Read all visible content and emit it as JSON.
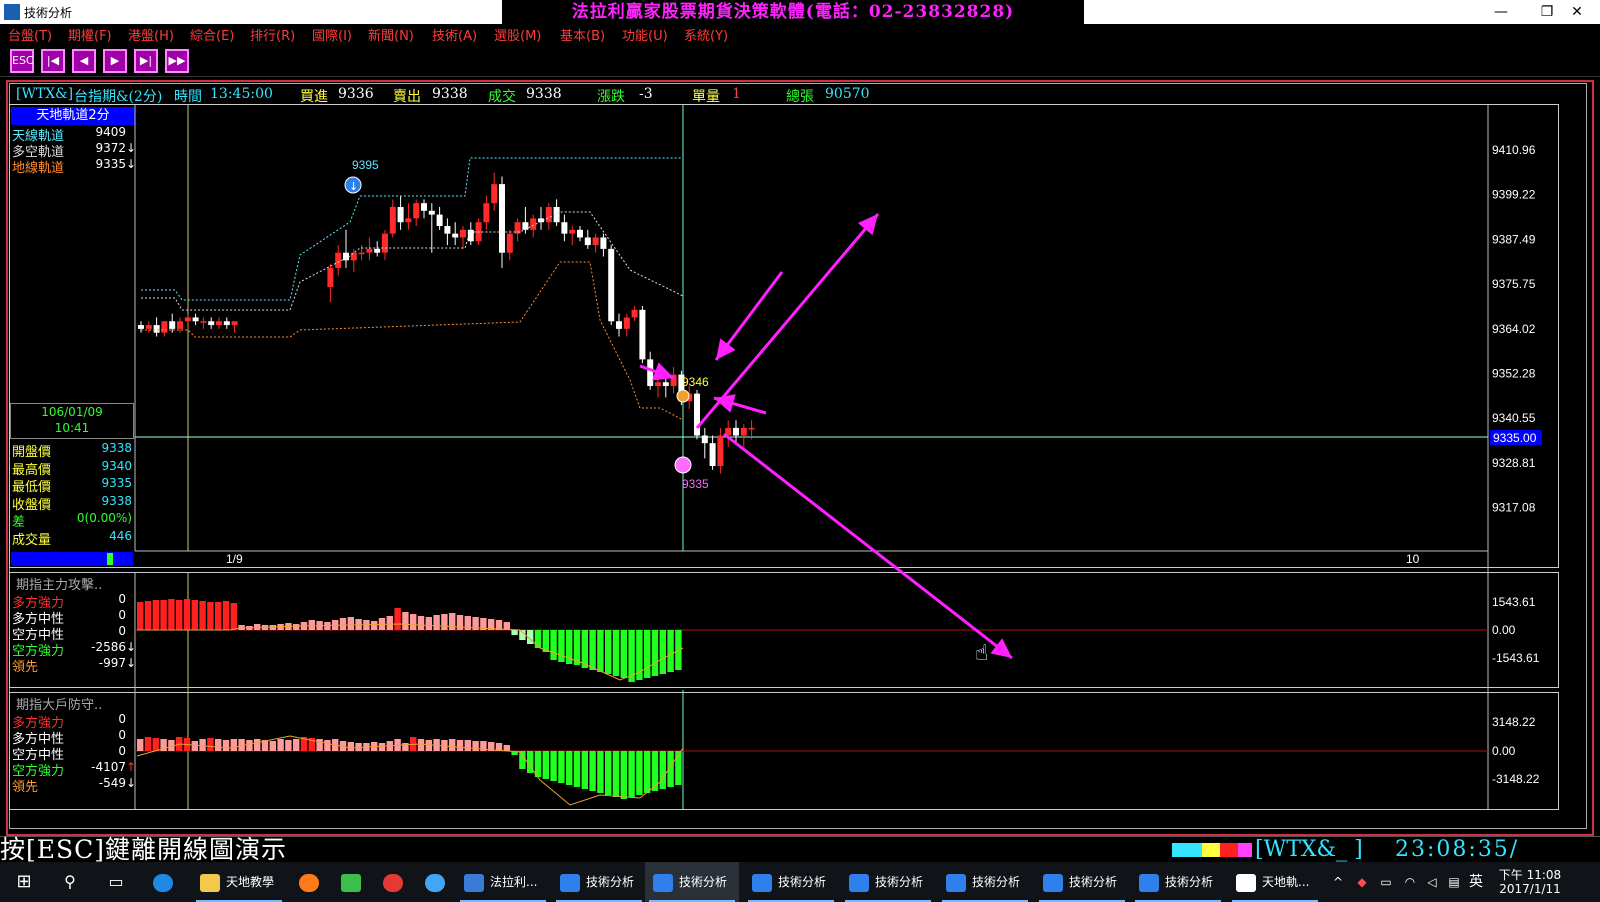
{
  "window": {
    "title": "技術分析",
    "banner": "法拉利贏家股票期貨決策軟體(電話：02-23832828)",
    "controls": [
      "—",
      "❐",
      "✕"
    ]
  },
  "menu": [
    "台盤(T)",
    "期權(F)",
    "港盤(H)",
    "綜合(E)",
    "排行(R)",
    "國際(I)",
    "新聞(N)",
    "技術(A)",
    "選股(M)",
    "基本(B)",
    "功能(U)",
    "系統(Y)"
  ],
  "toolbar": {
    "buttons": [
      {
        "name": "esc-button",
        "label": "ESC"
      },
      {
        "name": "first-button",
        "label": "|◀"
      },
      {
        "name": "prev-button",
        "label": "◀"
      },
      {
        "name": "next-button",
        "label": "▶"
      },
      {
        "name": "last-button",
        "label": "▶|"
      },
      {
        "name": "fast-forward-button",
        "label": "▶▶"
      }
    ]
  },
  "quote": {
    "symbol": "[WTX&]",
    "name": "台指期&(2分)",
    "time_label": "時間",
    "time": "13:45:00",
    "bid_label": "買進",
    "bid": "9336",
    "ask_label": "賣出",
    "ask": "9338",
    "last_label": "成交",
    "last": "9338",
    "change_label": "漲跌",
    "change": "-3",
    "vol_label": "單量",
    "vol": "1",
    "total_label": "總張",
    "total": "90570"
  },
  "main_panel": {
    "legend_title": "天地軌道2分",
    "legend": [
      {
        "label": "天線軌道",
        "value": "9409",
        "arrow": "",
        "color": "#5ce8ff"
      },
      {
        "label": "多空軌道",
        "value": "9372",
        "arrow": "↓",
        "color": "#dddddd"
      },
      {
        "label": "地線軌道",
        "value": "9335",
        "arrow": "↓",
        "color": "#ff8c2e"
      }
    ],
    "date": "106/01/09",
    "time": "10:41",
    "ohlc": [
      {
        "label": "開盤價",
        "value": "9338"
      },
      {
        "label": "最高價",
        "value": "9340"
      },
      {
        "label": "最低價",
        "value": "9335"
      },
      {
        "label": "收盤價",
        "value": "9338"
      },
      {
        "label": "差",
        "value": "0(0.00%)"
      },
      {
        "label": "成交量",
        "value": "446"
      }
    ],
    "price_axis": [
      "9410.96",
      "9399.22",
      "9387.49",
      "9375.75",
      "9364.02",
      "9352.28",
      "9340.55",
      "9328.81",
      "9317.08"
    ],
    "current_price": "9335.00",
    "x_labels": [
      "1/9",
      "10"
    ],
    "marker_high": "9395",
    "marker_mid": "9346",
    "marker_low": "9335"
  },
  "sub1": {
    "title": "期指主力攻擊..",
    "rows": [
      {
        "label": "多方強力",
        "value": "0",
        "arrow": "",
        "color": "#ff3030"
      },
      {
        "label": "多方中性",
        "value": "0",
        "arrow": "",
        "color": "#ffffff"
      },
      {
        "label": "空方中性",
        "value": "0",
        "arrow": "",
        "color": "#ffffff"
      },
      {
        "label": "空方強力",
        "value": "-2586",
        "arrow": "↓",
        "color": "#30ff30"
      },
      {
        "label": "領先",
        "value": "-997",
        "arrow": "↓",
        "color": "#ff9a30"
      }
    ],
    "axis": [
      "1543.61",
      "0.00",
      "-1543.61"
    ]
  },
  "sub2": {
    "title": "期指大戶防守..",
    "rows": [
      {
        "label": "多方強力",
        "value": "0",
        "arrow": "",
        "color": "#ff3030"
      },
      {
        "label": "多方中性",
        "value": "0",
        "arrow": "",
        "color": "#ffffff"
      },
      {
        "label": "空方中性",
        "value": "0",
        "arrow": "",
        "color": "#ffffff"
      },
      {
        "label": "空方強力",
        "value": "-4107",
        "arrow": "↑",
        "color": "#30ff30"
      },
      {
        "label": "領先",
        "value": "-549",
        "arrow": "↓",
        "color": "#ff9a30"
      }
    ],
    "axis": [
      "3148.22",
      "0.00",
      "-3148.22"
    ]
  },
  "status": {
    "message": "按[ESC]鍵離開線圖演示",
    "code": "[WTX&_ ]",
    "clock": "23:08:35/"
  },
  "taskbar": {
    "items": [
      {
        "name": "taskbar-folder",
        "label": "天地教學",
        "color": "#f2c94c"
      },
      {
        "name": "taskbar-ferrari",
        "label": "法拉利...",
        "color": "#3a7bd5"
      },
      {
        "name": "taskbar-ta1",
        "label": "技術分析",
        "color": "#2f80ed"
      },
      {
        "name": "taskbar-ta2",
        "label": "技術分析",
        "color": "#2f80ed"
      },
      {
        "name": "taskbar-ta3",
        "label": "技術分析",
        "color": "#2f80ed"
      },
      {
        "name": "taskbar-ta4",
        "label": "技術分析",
        "color": "#2f80ed"
      },
      {
        "name": "taskbar-ta5",
        "label": "技術分析",
        "color": "#2f80ed"
      },
      {
        "name": "taskbar-ta6",
        "label": "技術分析",
        "color": "#2f80ed"
      },
      {
        "name": "taskbar-ta7",
        "label": "技術分析",
        "color": "#2f80ed"
      },
      {
        "name": "taskbar-tiandi",
        "label": "天地軌...",
        "color": "#ffffff"
      }
    ],
    "ime": "英",
    "time": "下午 11:08",
    "date": "2017/1/11"
  }
}
